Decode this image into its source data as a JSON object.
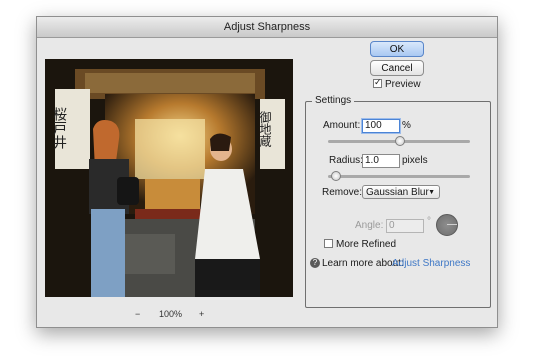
{
  "window": {
    "title": "Adjust Sharpness"
  },
  "buttons": {
    "ok": "OK",
    "cancel": "Cancel"
  },
  "preview_checkbox": {
    "label": "Preview",
    "checked": true
  },
  "zoom": {
    "minus": "−",
    "level": "100%",
    "plus": "+"
  },
  "settings": {
    "legend": "Settings",
    "amount": {
      "label": "Amount:",
      "value": "100",
      "unit": "%",
      "slider_fraction": 0.5
    },
    "radius": {
      "label": "Radius:",
      "value": "1.0",
      "unit": "pixels",
      "slider_fraction": 0.04
    },
    "remove": {
      "label": "Remove:",
      "selected": "Gaussian Blur"
    },
    "angle": {
      "label": "Angle:",
      "value": "0",
      "unit": "°"
    },
    "more_refined": {
      "label": "More Refined",
      "checked": false
    },
    "learn_more": {
      "prefix": "Learn more about:",
      "link": "Adjust Sharpness"
    }
  },
  "preview_image": {
    "description_icons": "photo-preview",
    "sign_left": "桜戸井",
    "sign_right": "御地蔵"
  },
  "colors": {
    "accent": "#3f78c6",
    "dialog_bg": "#e8e8e8"
  }
}
